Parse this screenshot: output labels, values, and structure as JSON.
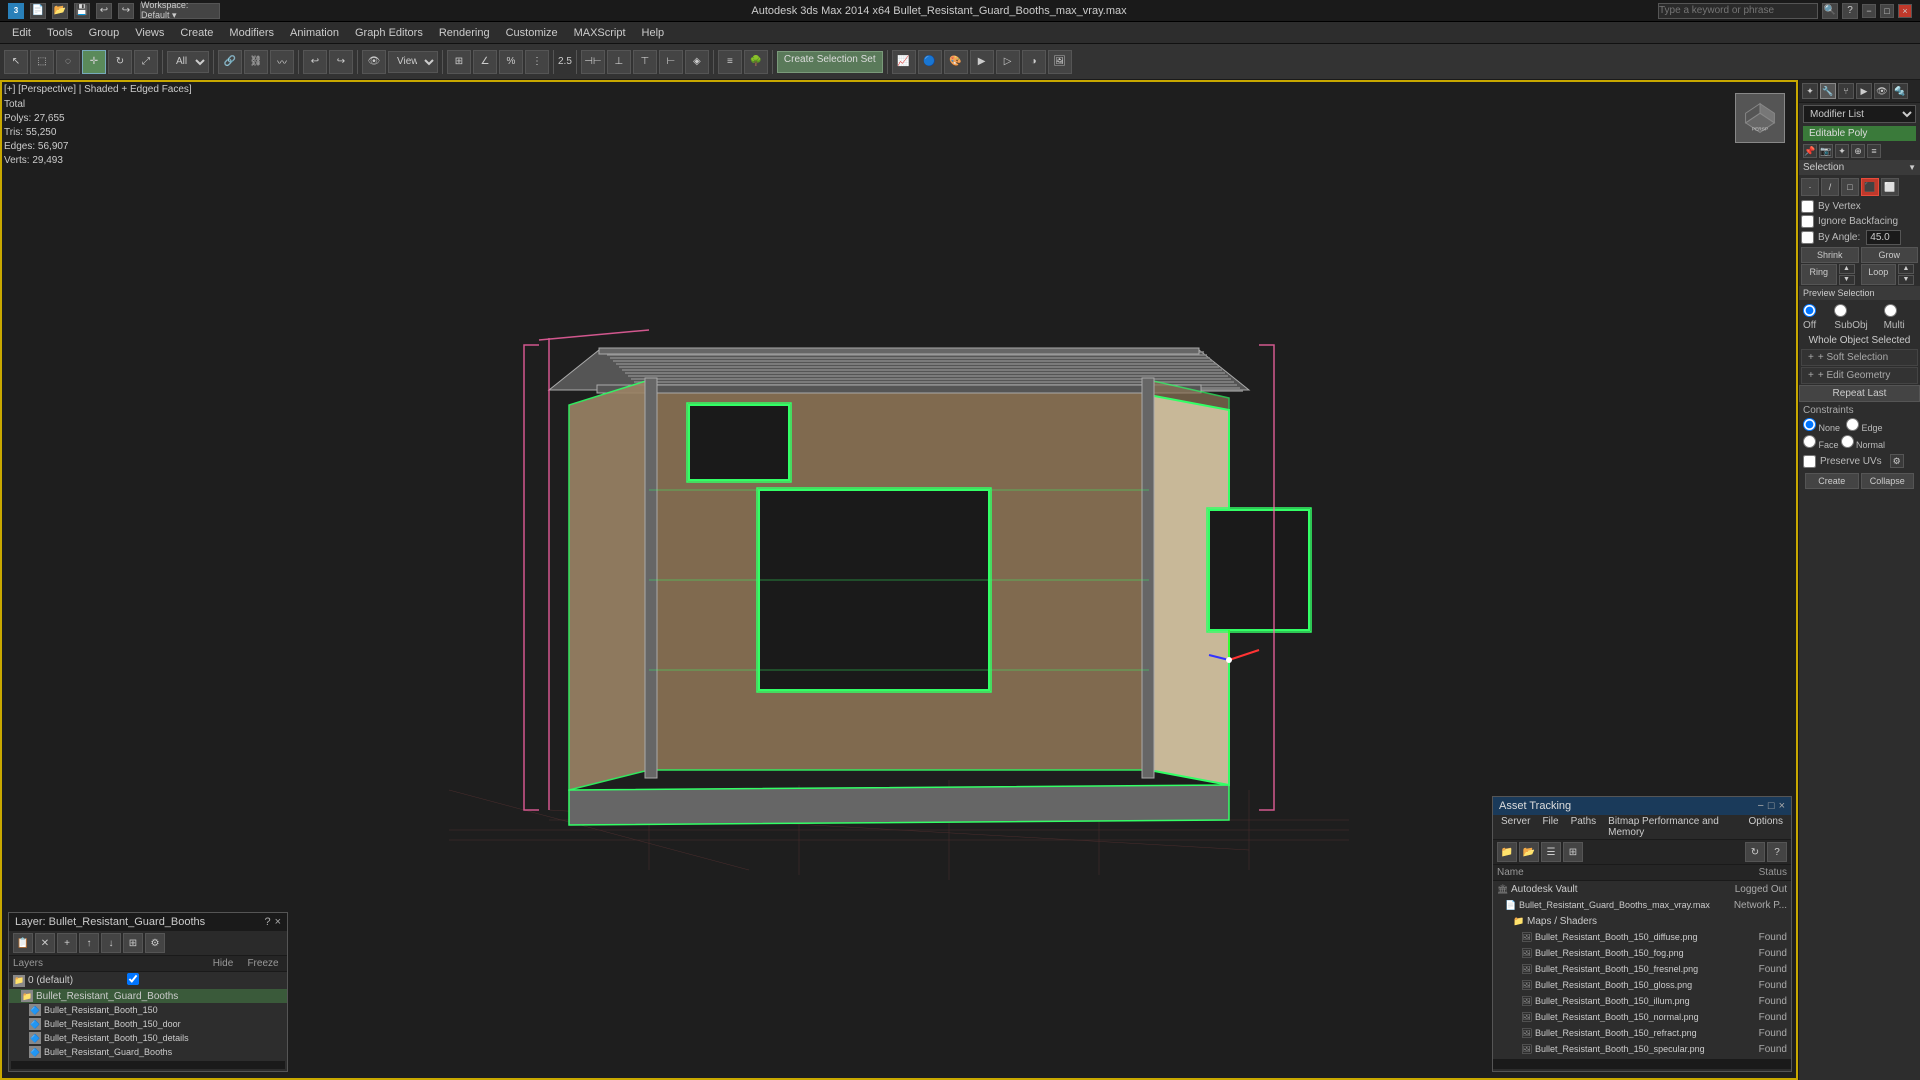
{
  "titlebar": {
    "app_icon": "3",
    "title": "Autodesk 3ds Max 2014 x64     Bullet_Resistant_Guard_Booths_max_vray.max",
    "search_placeholder": "Type a keyword or phrase",
    "minimize": "−",
    "maximize": "□",
    "close": "×"
  },
  "menubar": {
    "items": [
      "Edit",
      "Tools",
      "Group",
      "Views",
      "Create",
      "Modifiers",
      "Animation",
      "Graph Editors",
      "Rendering",
      "Customize",
      "MAXScript",
      "Help"
    ]
  },
  "toolbar": {
    "view_dropdown": "View",
    "percent_value": "2.5",
    "create_sel_label": "Create Selection Set",
    "all_dropdown": "All"
  },
  "viewport": {
    "label": "[+] [Perspective] | Shaded + Edged Faces]",
    "stats": {
      "polys_label": "Total",
      "polys": "Polys:  27,655",
      "tris": "Tris:    55,250",
      "edges": "Edges:  56,907",
      "verts": "Verts:  29,493"
    }
  },
  "right_panel": {
    "panel_tabs": [
      "pin",
      "camera",
      "light",
      "geometry",
      "helper"
    ],
    "modifier_list_label": "Modifier List",
    "modifier_item": "Editable Poly",
    "selection": {
      "title": "Selection",
      "by_vertex": "By Vertex",
      "ignore_backfacing": "Ignore Backfacing",
      "by_angle": "By Angle:",
      "angle_value": "45.0",
      "shrink": "Shrink",
      "grow": "Grow",
      "ring": "Ring",
      "loop": "Loop"
    },
    "preview_selection": {
      "title": "Preview Selection",
      "off": "Off",
      "subobj": "SubObj",
      "multi": "Multi"
    },
    "whole_object_selected": "Whole Object Selected",
    "soft_selection": "+ Soft Selection",
    "edit_geometry": "+ Edit Geometry",
    "repeat_last": "Repeat Last",
    "constraints": {
      "title": "Constraints",
      "none": "None",
      "edge": "Edge",
      "face": "Face",
      "normal": "Normal",
      "preserve_uvs": "Preserve UVs"
    },
    "create_btn": "Create",
    "collapse_btn": "Collapse"
  },
  "layer_panel": {
    "title": "Layer: Bullet_Resistant_Guard_Booths",
    "question_icon": "?",
    "close_icon": "×",
    "toolbar_icons": [
      "new_layer",
      "delete",
      "add",
      "move_up",
      "move_down",
      "select_all",
      "options"
    ],
    "layers_label": "Layers",
    "hide_label": "Hide",
    "freeze_label": "Freeze",
    "rows": [
      {
        "name": "0 (default)",
        "indent": 0,
        "selected": false,
        "check": true
      },
      {
        "name": "Bullet_Resistant_Guard_Booths",
        "indent": 1,
        "selected": true,
        "check": false
      },
      {
        "name": "Bullet_Resistant_Booth_150",
        "indent": 2,
        "selected": false,
        "check": false
      },
      {
        "name": "Bullet_Resistant_Booth_150_door",
        "indent": 2,
        "selected": false,
        "check": false
      },
      {
        "name": "Bullet_Resistant_Booth_150_details",
        "indent": 2,
        "selected": false,
        "check": false
      },
      {
        "name": "Bullet_Resistant_Guard_Booths",
        "indent": 2,
        "selected": false,
        "check": false
      }
    ]
  },
  "asset_panel": {
    "title": "Asset Tracking",
    "menus": [
      "Server",
      "File",
      "Paths",
      "Bitmap Performance and Memory",
      "Options"
    ],
    "toolbar_icons": [
      "folder",
      "folder2",
      "list",
      "grid"
    ],
    "name_col": "Name",
    "status_col": "Status",
    "rows": [
      {
        "name": "Autodesk Vault",
        "status": "Logged Out",
        "indent": 0,
        "type": "vault"
      },
      {
        "name": "Bullet_Resistant_Guard_Booths_max_vray.max",
        "status": "Network P...",
        "indent": 1,
        "type": "file"
      },
      {
        "name": "Maps / Shaders",
        "status": "",
        "indent": 2,
        "type": "folder"
      },
      {
        "name": "Bullet_Resistant_Booth_150_diffuse.png",
        "status": "Found",
        "indent": 3,
        "type": "image"
      },
      {
        "name": "Bullet_Resistant_Booth_150_fog.png",
        "status": "Found",
        "indent": 3,
        "type": "image"
      },
      {
        "name": "Bullet_Resistant_Booth_150_fresnel.png",
        "status": "Found",
        "indent": 3,
        "type": "image"
      },
      {
        "name": "Bullet_Resistant_Booth_150_gloss.png",
        "status": "Found",
        "indent": 3,
        "type": "image"
      },
      {
        "name": "Bullet_Resistant_Booth_150_illum.png",
        "status": "Found",
        "indent": 3,
        "type": "image"
      },
      {
        "name": "Bullet_Resistant_Booth_150_normal.png",
        "status": "Found",
        "indent": 3,
        "type": "image"
      },
      {
        "name": "Bullet_Resistant_Booth_150_refract.png",
        "status": "Found",
        "indent": 3,
        "type": "image"
      },
      {
        "name": "Bullet_Resistant_Booth_150_specular.png",
        "status": "Found",
        "indent": 3,
        "type": "image"
      }
    ]
  }
}
